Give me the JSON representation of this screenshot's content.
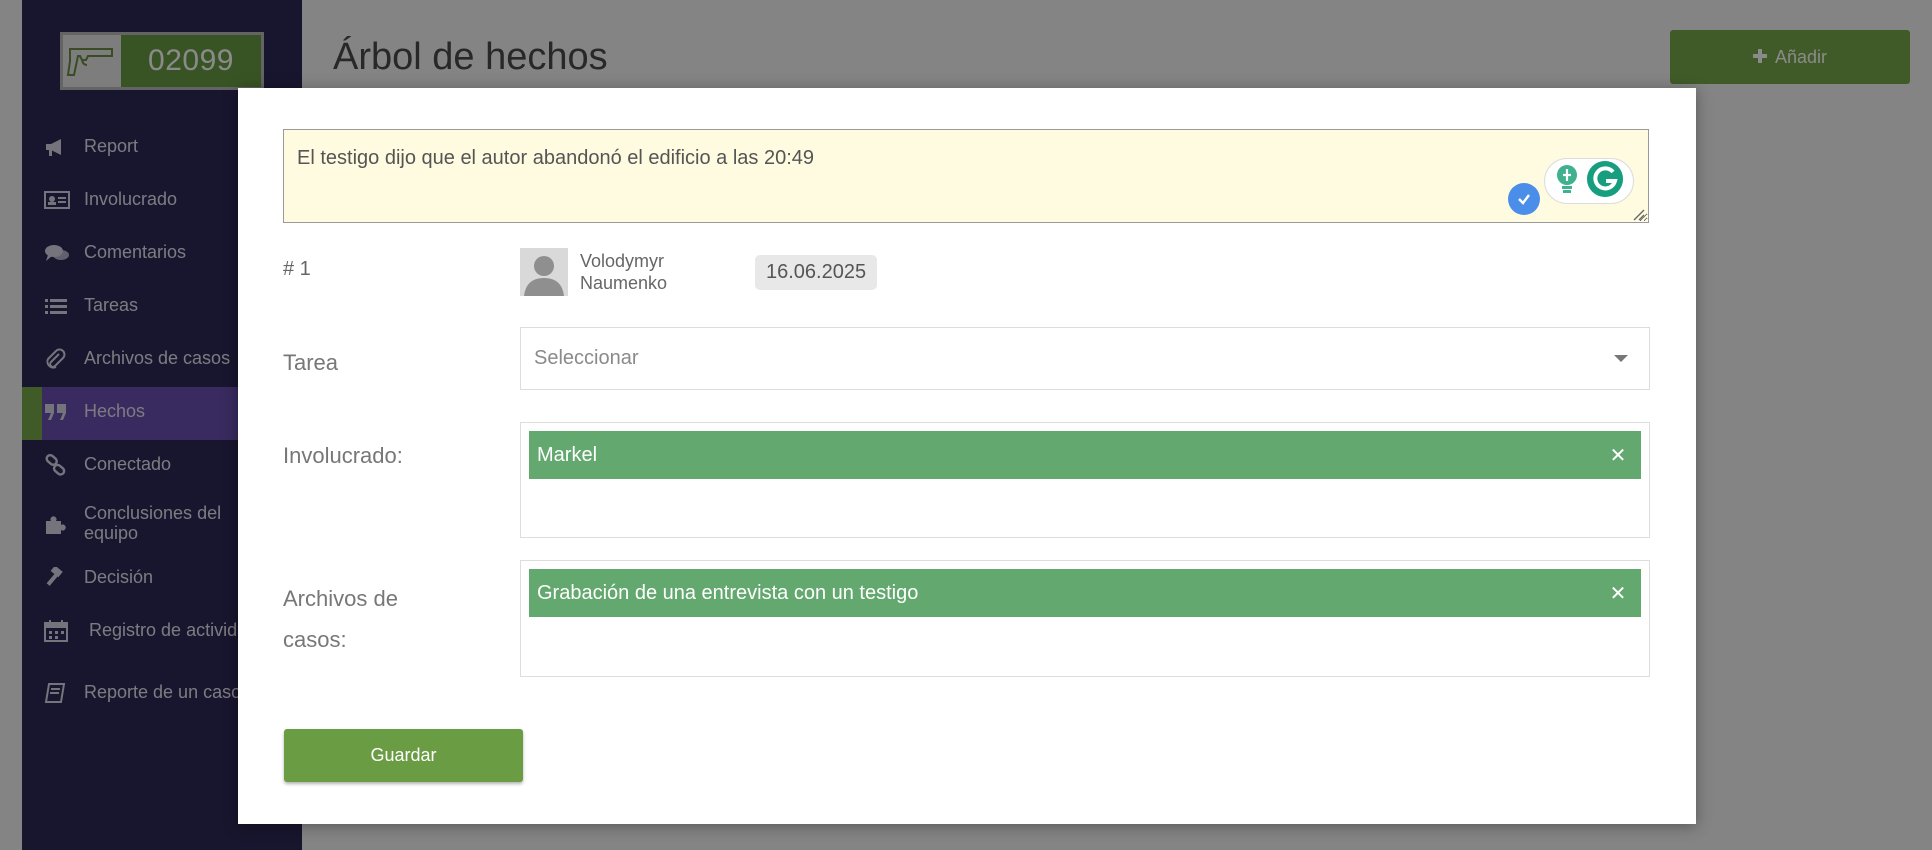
{
  "case": {
    "number": "02099",
    "icon": "gun-icon"
  },
  "sidebar": {
    "items": [
      {
        "label": "Report",
        "icon": "megaphone-icon"
      },
      {
        "label": "Involucrado",
        "icon": "id-card-icon"
      },
      {
        "label": "Comentarios",
        "icon": "comments-icon"
      },
      {
        "label": "Tareas",
        "icon": "list-icon"
      },
      {
        "label": "Archivos de casos",
        "icon": "paperclip-icon"
      },
      {
        "label": "Hechos",
        "icon": "quote-icon",
        "active": true
      },
      {
        "label": "Conectado",
        "icon": "link-icon"
      },
      {
        "label": "Conclusiones del equipo",
        "icon": "puzzle-icon"
      },
      {
        "label": "Decisión",
        "icon": "gavel-icon"
      },
      {
        "label": "Registro de actividades",
        "icon": "calendar-icon"
      },
      {
        "label": "Reporte de un caso",
        "icon": "book-icon"
      }
    ]
  },
  "header": {
    "title": "Árbol de hechos",
    "add_label": "Añadir",
    "add_icon": "plus-icon"
  },
  "modal": {
    "fact_text": "El testigo dijo que el autor abandonó el edificio a las 20:49",
    "fact_number": "# 1",
    "author": {
      "first": "Volodymyr",
      "last": "Naumenko"
    },
    "date": "16.06.2025",
    "task": {
      "label": "Tarea",
      "placeholder": "Seleccionar"
    },
    "involved": {
      "label": "Involucrado:",
      "chips": [
        "Markel"
      ]
    },
    "files": {
      "label": "Archivos de casos:",
      "chips": [
        "Grabación de una entrevista con un testigo"
      ]
    },
    "save_label": "Guardar"
  },
  "colors": {
    "sidebar_bg": "#2d2755",
    "active_item": "#6a4fb0",
    "accent_green": "#76a94b",
    "chip_green": "#63a86e",
    "textarea_bg": "#fffbe0"
  }
}
